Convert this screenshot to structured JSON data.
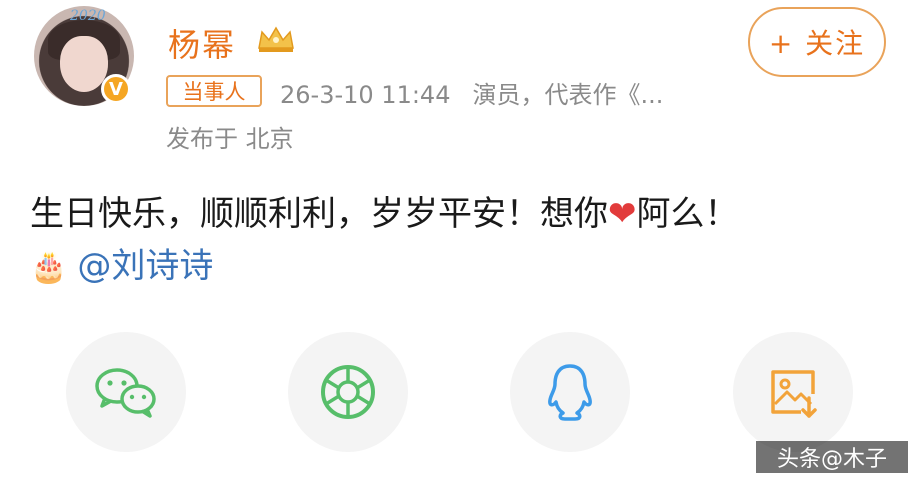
{
  "post": {
    "author": "杨幂",
    "avatar_text": "2020",
    "verified_badge": "V",
    "role_tag": "当事人",
    "time": "26-3-10 11:44",
    "bio": "演员，代表作《...",
    "location": "发布于 北京",
    "follow_label": "+ 关注",
    "text": "生日快乐，顺顺利利，岁岁平安！想你",
    "heart": "❤",
    "text_after_heart": "阿么！",
    "cake_emoji": "🎂",
    "mention": "@刘诗诗"
  },
  "share": {
    "icons": [
      "wechat-icon",
      "moments-icon",
      "qq-icon",
      "save-image-icon"
    ]
  },
  "watermark": {
    "text": "头条@木子"
  },
  "colors": {
    "accent": "#e8721c",
    "mention": "#3a73b8",
    "meta_gray": "#8a8a8a",
    "wechat_green": "#57be6a",
    "qq_blue": "#3d9be9",
    "save_orange": "#f2a33a"
  }
}
